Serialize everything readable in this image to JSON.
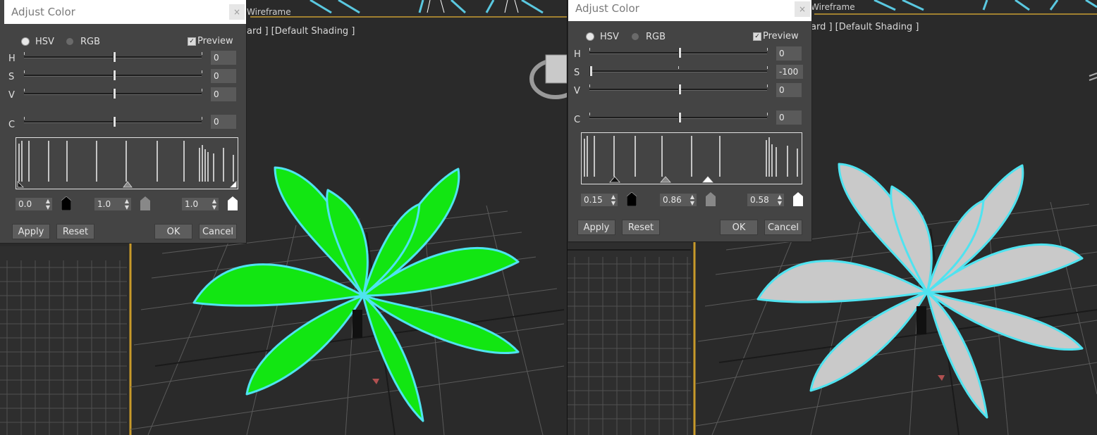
{
  "viewport": {
    "label_fragment_left": "ard ] [Default Shading ]",
    "label_fragment_right": "ard ] [Default Shading ]",
    "wire_label": "Wireframe",
    "left_plant_color": "#12e612",
    "right_plant_color": "#c9c9c9",
    "outline_color": "#4fe3f0"
  },
  "dialog_left": {
    "title": "Adjust Color",
    "close_icon": "×",
    "mode_hsv": "HSV",
    "mode_rgb": "RGB",
    "preview_label": "Preview",
    "sliders": [
      {
        "label": "H",
        "value": "0"
      },
      {
        "label": "S",
        "value": "0"
      },
      {
        "label": "V",
        "value": "0"
      },
      {
        "label": "C",
        "value": "0"
      }
    ],
    "levels": [
      "0.0",
      "1.0",
      "1.0"
    ],
    "buttons": {
      "apply": "Apply",
      "reset": "Reset",
      "ok": "OK",
      "cancel": "Cancel"
    }
  },
  "dialog_right": {
    "title": "Adjust Color",
    "close_icon": "×",
    "mode_hsv": "HSV",
    "mode_rgb": "RGB",
    "preview_label": "Preview",
    "sliders": [
      {
        "label": "H",
        "value": "0"
      },
      {
        "label": "S",
        "value": "-100"
      },
      {
        "label": "V",
        "value": "0"
      },
      {
        "label": "C",
        "value": "0"
      }
    ],
    "levels": [
      "0.15",
      "0.86",
      "0.58"
    ],
    "buttons": {
      "apply": "Apply",
      "reset": "Reset",
      "ok": "OK",
      "cancel": "Cancel"
    }
  }
}
